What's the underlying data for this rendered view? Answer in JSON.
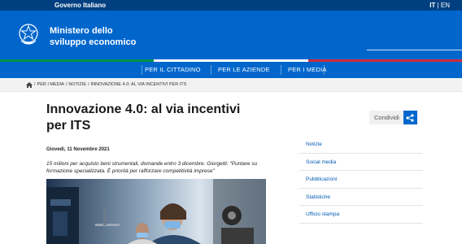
{
  "gov_bar": {
    "name": "Governo Italiano",
    "lang_active": "IT",
    "lang_sep": "|",
    "lang_other": "EN"
  },
  "header": {
    "ministry_line1": "Ministero dello",
    "ministry_line2": "sviluppo economico"
  },
  "tricolor": [
    "#009246",
    "#ffffff",
    "#ce2b37"
  ],
  "nav": {
    "items": [
      "PER IL CITTADINO",
      "PER LE AZIENDE",
      "PER I MEDIA"
    ]
  },
  "breadcrumb": [
    "PER I MEDIA",
    "NOTIZIE",
    "INNOVAZIONE 4.0: AL VIA INCENTIVI PER ITS"
  ],
  "article": {
    "title": "Innovazione 4.0: al via incentivi per ITS",
    "date": "Giovedì, 11 Novembre 2021",
    "summary": "15 milioni per acquisto beni strumentali, domande entro 3 dicembre. Giorgetti: \"Puntare su formazione specializzata. È priorità per rafforzare competitività imprese\""
  },
  "share": {
    "label": "Condividi"
  },
  "sidebar": {
    "items": [
      "Notizie",
      "Social media",
      "Pubblicazioni",
      "Statistiche",
      "Ufficio stampa"
    ]
  },
  "colors": {
    "brand_blue": "#0066cc",
    "dark_blue": "#004080"
  }
}
